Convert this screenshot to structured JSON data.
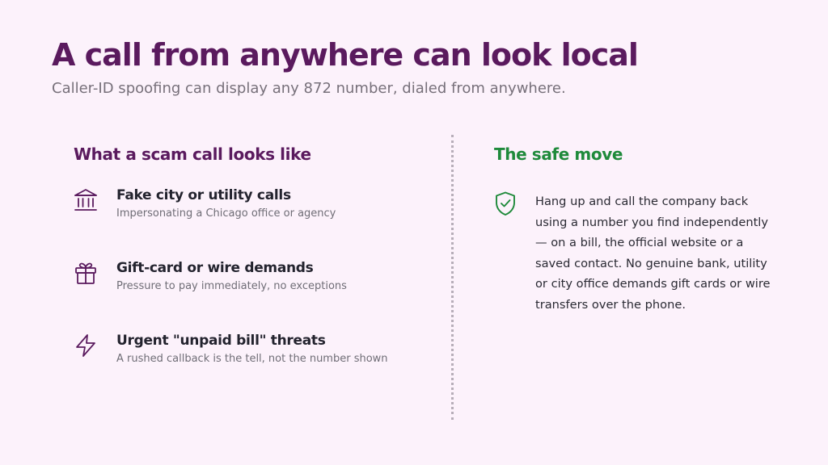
{
  "slide": {
    "title": "A call from anywhere can look local",
    "subtitle": "Caller-ID spoofing can display any 872 number, dialed from anywhere."
  },
  "scam_column": {
    "heading": "What a scam call looks like",
    "items": [
      {
        "icon": "bank-building-icon",
        "title": "Fake city or utility calls",
        "description": "Impersonating a Chicago office or agency"
      },
      {
        "icon": "gift-icon",
        "title": "Gift-card or wire demands",
        "description": "Pressure to pay immediately, no exceptions"
      },
      {
        "icon": "lightning-bolt-icon",
        "title": "Urgent \"unpaid bill\" threats",
        "description": "A rushed callback is the tell, not the number shown"
      }
    ]
  },
  "safe_column": {
    "heading": "The safe move",
    "icon": "shield-check-icon",
    "text": "Hang up and call the company back using a number you find independently — on a bill, the official website or a saved contact. No genuine bank, utility or city office demands gift cards or wire transfers over the phone."
  },
  "colors": {
    "background": "#fcf2fb",
    "primary_purple": "#5a1a5e",
    "safe_green": "#1f8a3b",
    "body_text": "#23232e",
    "muted_text": "#6f6d76"
  }
}
